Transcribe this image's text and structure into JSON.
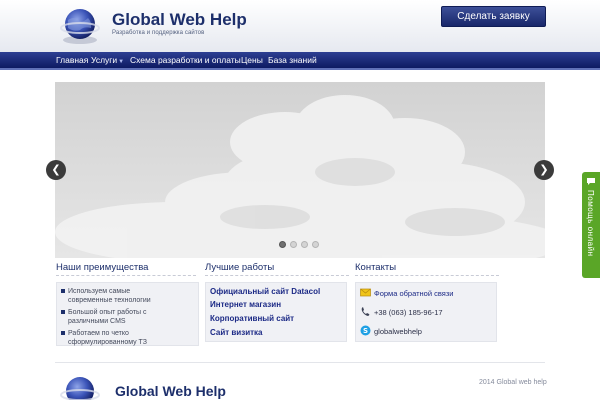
{
  "header": {
    "brand": "Global Web Help",
    "tagline": "Разработка и поддержка сайтов",
    "order_button": "Сделать заявку"
  },
  "nav": {
    "items": [
      {
        "label": "Главная"
      },
      {
        "label": "Услуги",
        "has_dropdown": true
      },
      {
        "label": "Схема разработки и оплаты"
      },
      {
        "label": "Цены"
      },
      {
        "label": "База знаний"
      }
    ]
  },
  "slider": {
    "slide_count": 4,
    "active_slide": 1,
    "prev_icon": "chevron-left-icon",
    "next_icon": "chevron-right-icon"
  },
  "side_tab": {
    "label": "Помощь онлайн",
    "color": "#5aa627"
  },
  "benefits": {
    "title": "Наши преимущества",
    "items": [
      "Используем самые современные технологии",
      "Большой опыт работы с различными CMS",
      "Работаем по четко сформулированному ТЗ"
    ]
  },
  "works": {
    "title": "Лучшие работы",
    "items": [
      "Официальный сайт Datacol",
      "Интернет магазин",
      "Корпоративный сайт",
      "Сайт визитка"
    ]
  },
  "contacts": {
    "title": "Контакты",
    "feedback_link": "Форма обратной связи",
    "phone": "+38 (063) 185-96-17",
    "skype": "globalwebhelp"
  },
  "footer": {
    "brand": "Global Web Help",
    "copyright": "2014 Global web help"
  },
  "colors": {
    "brand_navy": "#1d2f6b",
    "nav_bg": "#16256e",
    "link": "#1c2a86"
  }
}
